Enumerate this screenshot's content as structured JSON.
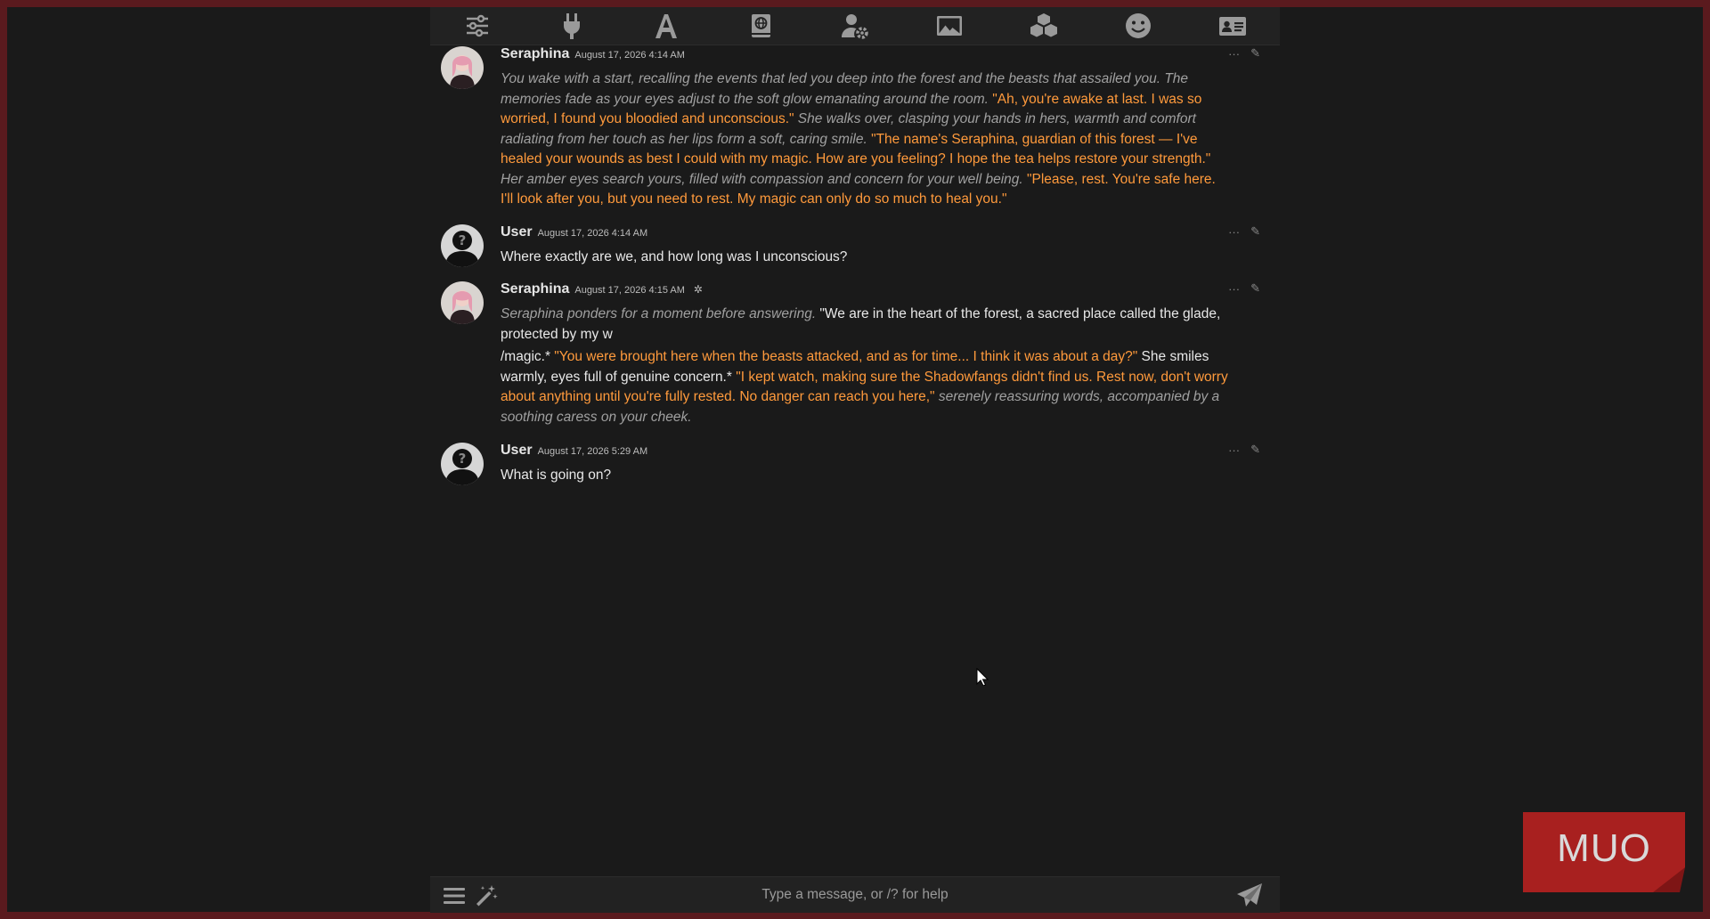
{
  "input": {
    "placeholder": "Type a message, or /? for help"
  },
  "toolbar": {
    "items": [
      {
        "name": "ai-settings-icon"
      },
      {
        "name": "api-connections-icon"
      },
      {
        "name": "formatting-icon"
      },
      {
        "name": "world-info-icon"
      },
      {
        "name": "user-settings-icon"
      },
      {
        "name": "backgrounds-icon"
      },
      {
        "name": "extensions-icon"
      },
      {
        "name": "persona-icon"
      },
      {
        "name": "character-card-icon"
      }
    ]
  },
  "messages": [
    {
      "name": "Seraphina",
      "time": "August 17, 2026 4:14 AM",
      "paragraphs": [
        [
          {
            "style": "nar",
            "text": "You wake with a start, recalling the events that led you deep into the forest and the beasts that assailed you. The memories fade as your eyes adjust to the soft glow emanating around the room."
          },
          {
            "style": "sp",
            "text": " \"Ah, you're awake at last. I was so worried, I found you bloodied and unconscious.\""
          },
          {
            "style": "nar",
            "text": " She walks over, clasping your hands in hers, warmth and comfort radiating from her touch as her lips form a soft, caring smile."
          },
          {
            "style": "sp",
            "text": " \"The name's Seraphina, guardian of this forest — I've healed your wounds as best I could with my magic. How are you feeling? I hope the tea helps restore your strength.\""
          },
          {
            "style": "nar",
            "text": " Her amber eyes search yours, filled with compassion and concern for your well being."
          },
          {
            "style": "sp",
            "text": " \"Please, rest. You're safe here. I'll look after you, but you need to rest. My magic can only do so much to heal you.\""
          }
        ]
      ]
    },
    {
      "name": "User",
      "time": "August 17, 2026 4:14 AM",
      "paragraphs": [
        [
          {
            "style": "pl",
            "text": "Where exactly are we, and how long was I unconscious?"
          }
        ]
      ]
    },
    {
      "name": "Seraphina",
      "time": "August 17, 2026 4:15 AM",
      "flag": "✲",
      "paragraphs": [
        [
          {
            "style": "nar",
            "text": "Seraphina ponders for a moment before answering."
          },
          {
            "style": "pl",
            "text": " \"We are in the heart of the forest, a sacred place called the glade, protected by my w"
          }
        ],
        [
          {
            "style": "pl",
            "text": "/magic.*"
          },
          {
            "style": "sp",
            "text": " \"You were brought here when the beasts attacked, and as for time... I think it was about a day?\""
          },
          {
            "style": "pl",
            "text": " She smiles warmly, eyes full of genuine concern.*"
          },
          {
            "style": "sp",
            "text": " \"I kept watch, making sure the Shadowfangs didn't find us. Rest now, don't worry about anything until you're fully rested. No danger can reach you here,\""
          },
          {
            "style": "nar",
            "text": " serenely reassuring words, accompanied by a soothing caress on your cheek."
          }
        ]
      ]
    },
    {
      "name": "User",
      "time": "August 17, 2026 5:29 AM",
      "paragraphs": [
        [
          {
            "style": "pl",
            "text": "What is going on?"
          }
        ]
      ]
    }
  ],
  "actions": {
    "more": "···",
    "edit": "✎"
  },
  "watermark": {
    "text": "MUO",
    "color": "#a8201f"
  },
  "colors": {
    "speech": "#ff9a3c",
    "narration": "#a0a0a0",
    "background": "#1a1a1a",
    "border": "#5a1a1e"
  }
}
